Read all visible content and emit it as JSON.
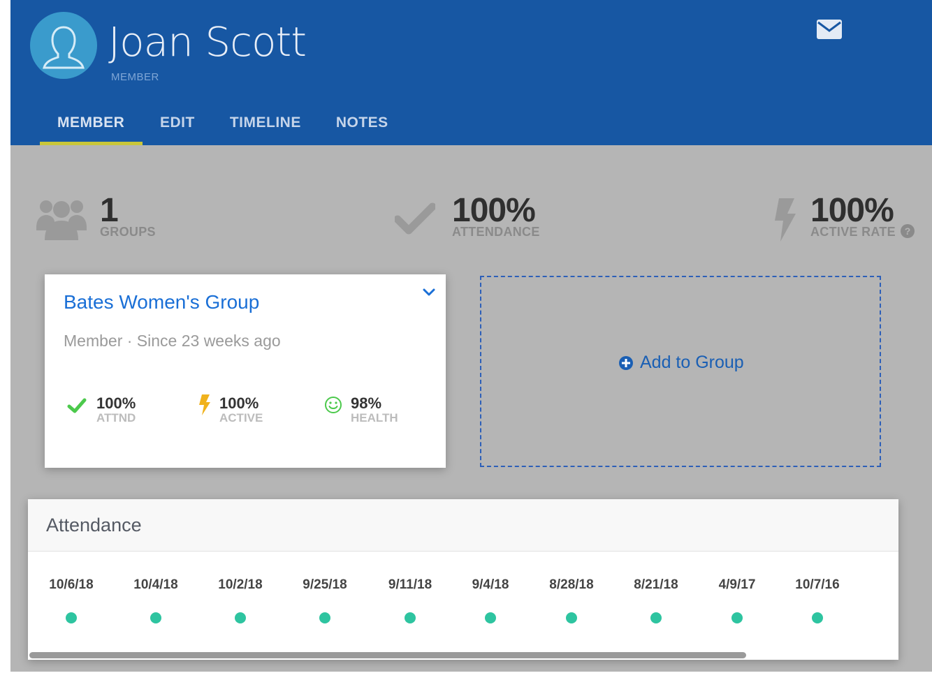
{
  "profile": {
    "name": "Joan Scott",
    "role": "MEMBER"
  },
  "header": {
    "mail_icon": "envelope-icon"
  },
  "tabs": [
    {
      "label": "MEMBER",
      "active": true
    },
    {
      "label": "EDIT",
      "active": false
    },
    {
      "label": "TIMELINE",
      "active": false
    },
    {
      "label": "NOTES",
      "active": false
    }
  ],
  "stats": {
    "groups": {
      "value": "1",
      "label": "GROUPS",
      "icon": "users-icon"
    },
    "attendance": {
      "value": "100%",
      "label": "ATTENDANCE",
      "icon": "check-icon"
    },
    "active_rate": {
      "value": "100%",
      "label": "ACTIVE RATE",
      "icon": "lightning-icon"
    }
  },
  "group_card": {
    "title": "Bates Women's Group",
    "subtitle": "Member · Since 23 weeks ago",
    "metrics": [
      {
        "value": "100%",
        "label": "ATTND",
        "icon": "check-icon",
        "color": "#4cc94c"
      },
      {
        "value": "100%",
        "label": "ACTIVE",
        "icon": "lightning-icon",
        "color": "#f0b21c"
      },
      {
        "value": "98%",
        "label": "HEALTH",
        "icon": "smiley-icon",
        "color": "#4cc94c"
      }
    ]
  },
  "add_group": {
    "label": "Add to Group"
  },
  "attendance": {
    "title": "Attendance",
    "dates": [
      "10/6/18",
      "10/4/18",
      "10/2/18",
      "9/25/18",
      "9/11/18",
      "9/4/18",
      "8/28/18",
      "8/21/18",
      "4/9/17",
      "10/7/16"
    ],
    "dot_color": "#2ec4a0"
  },
  "colors": {
    "header": "#1757a3",
    "accent_tab": "#c9c63a",
    "link": "#1a6fd6"
  }
}
